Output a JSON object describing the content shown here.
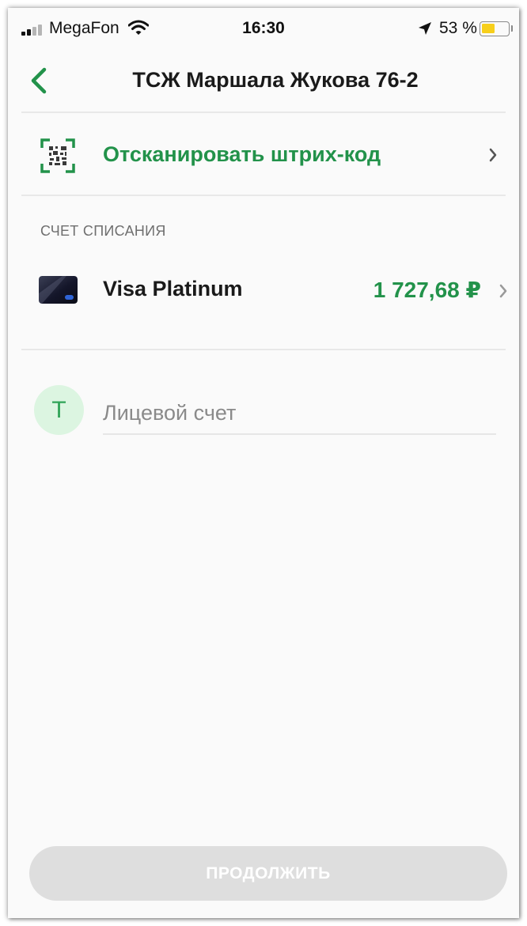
{
  "status_bar": {
    "carrier": "MegaFon",
    "time": "16:30",
    "battery_percent_label": "53 %",
    "battery_level": 0.53,
    "icons": [
      "signal-icon",
      "wifi-icon",
      "location-arrow-icon",
      "battery-icon"
    ]
  },
  "nav": {
    "title": "ТСЖ Маршала Жукова 76-2",
    "back_icon": "chevron-left-icon"
  },
  "scan": {
    "label": "Отсканировать штрих-код",
    "icon": "barcode-scan-icon"
  },
  "debit_account": {
    "section_label": "СЧЕТ СПИСАНИЯ",
    "card_name": "Visa Platinum",
    "balance": "1 727,68 ₽",
    "icon": "card-icon"
  },
  "personal_account": {
    "avatar_letter": "Т",
    "placeholder": "Лицевой счет",
    "value": ""
  },
  "continue_button": {
    "label": "ПРОДОЛЖИТЬ",
    "enabled": false
  },
  "colors": {
    "accent": "#22924a",
    "avatar_bg": "#dcf5e1",
    "button_disabled": "#dedede",
    "battery": "#f7cf1b"
  }
}
